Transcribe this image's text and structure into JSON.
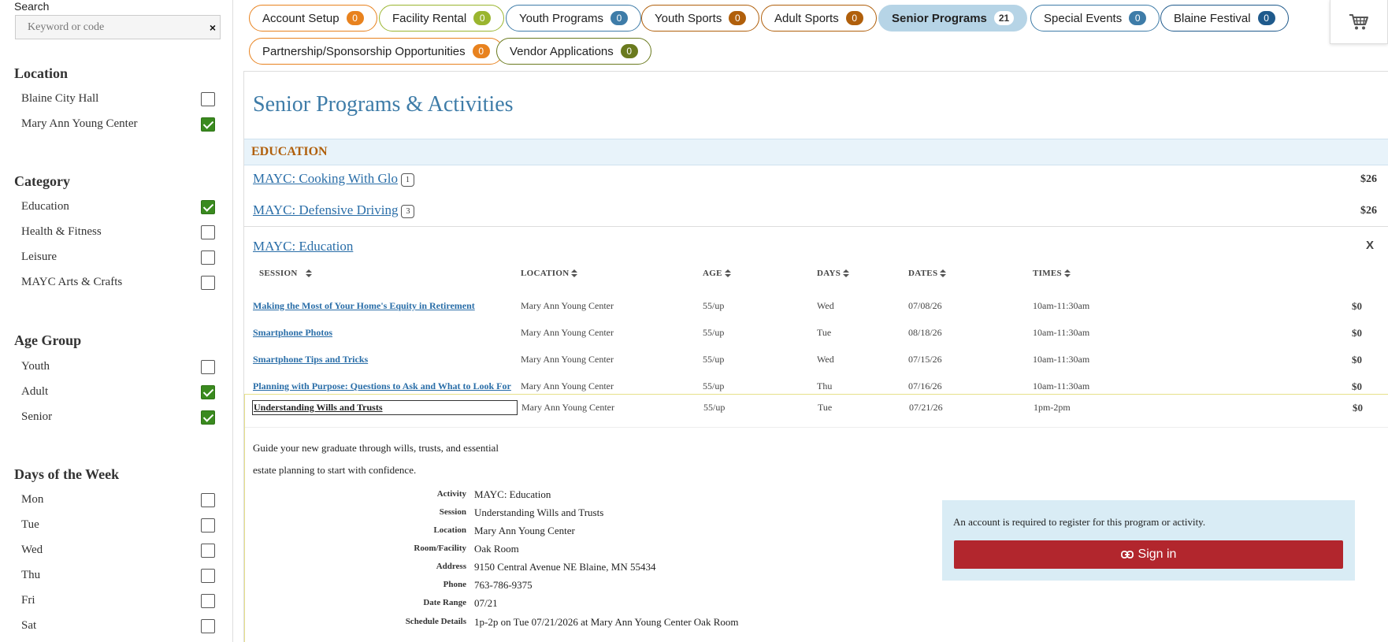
{
  "sidebar": {
    "search_label": "Search",
    "search_placeholder": "Keyword or code",
    "clear_icon": "×",
    "groups": [
      {
        "title": "Location",
        "items": [
          {
            "label": "Blaine City Hall",
            "checked": false
          },
          {
            "label": "Mary Ann Young Center",
            "checked": true
          }
        ]
      },
      {
        "title": "Category",
        "items": [
          {
            "label": "Education",
            "checked": true
          },
          {
            "label": "Health & Fitness",
            "checked": false
          },
          {
            "label": "Leisure",
            "checked": false
          },
          {
            "label": "MAYC Arts & Crafts",
            "checked": false
          }
        ]
      },
      {
        "title": "Age Group",
        "items": [
          {
            "label": "Youth",
            "checked": false
          },
          {
            "label": "Adult",
            "checked": true
          },
          {
            "label": "Senior",
            "checked": true
          }
        ]
      },
      {
        "title": "Days of the Week",
        "items": [
          {
            "label": "Mon",
            "checked": false
          },
          {
            "label": "Tue",
            "checked": false
          },
          {
            "label": "Wed",
            "checked": false
          },
          {
            "label": "Thu",
            "checked": false
          },
          {
            "label": "Fri",
            "checked": false
          },
          {
            "label": "Sat",
            "checked": false
          }
        ]
      }
    ]
  },
  "tabs": [
    {
      "label": "Account Setup",
      "count": "0",
      "color": "#e8821e",
      "active": false
    },
    {
      "label": "Facility Rental",
      "count": "0",
      "color": "#9ab52f",
      "active": false
    },
    {
      "label": "Youth Programs",
      "count": "0",
      "color": "#3e7ca8",
      "active": false
    },
    {
      "label": "Youth Sports",
      "count": "0",
      "color": "#b05f0b",
      "active": false
    },
    {
      "label": "Adult Sports",
      "count": "0",
      "color": "#b05f0b",
      "active": false
    },
    {
      "label": "Senior Programs",
      "count": "21",
      "color": "#3e7ca8",
      "active": true
    },
    {
      "label": "Special Events",
      "count": "0",
      "color": "#3e7ca8",
      "active": false
    },
    {
      "label": "Blaine Festival",
      "count": "0",
      "color": "#1f5a8c",
      "active": false
    },
    {
      "label": "Partnership/Sponsorship Opportunities",
      "count": "0",
      "color": "#e8821e",
      "active": false
    },
    {
      "label": "Vendor Applications",
      "count": "0",
      "color": "#6a7a1e",
      "active": false
    }
  ],
  "cart_icon": "shopping-cart-icon",
  "main": {
    "page_title": "Senior Programs & Activities",
    "section_title": "EDUCATION",
    "activities": [
      {
        "name": "MAYC: Cooking With Glo",
        "badge": "1",
        "price": "$26"
      },
      {
        "name": "MAYC: Defensive Driving",
        "badge": "3",
        "price": "$26"
      },
      {
        "name": "MAYC: Education",
        "close": "X"
      }
    ],
    "table": {
      "headers": [
        "SESSION",
        "LOCATION",
        "AGE",
        "DAYS",
        "DATES",
        "TIMES"
      ],
      "rows": [
        {
          "session": "Making the Most of Your Home's Equity in Retirement",
          "location": "Mary Ann Young Center",
          "age": "55/up",
          "days": "Wed",
          "dates": "07/08/26",
          "times": "10am-11:30am",
          "price": "$0"
        },
        {
          "session": "Smartphone Photos",
          "location": "Mary Ann Young Center",
          "age": "55/up",
          "days": "Tue",
          "dates": "08/18/26",
          "times": "10am-11:30am",
          "price": "$0"
        },
        {
          "session": "Smartphone Tips and Tricks",
          "location": "Mary Ann Young Center",
          "age": "55/up",
          "days": "Wed",
          "dates": "07/15/26",
          "times": "10am-11:30am",
          "price": "$0"
        },
        {
          "session": "Planning with Purpose: Questions to Ask and What to Look For",
          "location": "Mary Ann Young Center",
          "age": "55/up",
          "days": "Thu",
          "dates": "07/16/26",
          "times": "10am-11:30am",
          "price": "$0"
        },
        {
          "session": "Understanding Wills and Trusts",
          "location": "Mary Ann Young Center",
          "age": "55/up",
          "days": "Tue",
          "dates": "07/21/26",
          "times": "1pm-2pm",
          "price": "$0"
        }
      ]
    },
    "details": {
      "description": "Guide your new graduate through wills, trusts, and essential estate planning to start with confidence.",
      "fields": [
        {
          "k": "Activity",
          "v": "MAYC: Education"
        },
        {
          "k": "Session",
          "v": "Understanding Wills and Trusts"
        },
        {
          "k": "Location",
          "v": "Mary Ann Young Center"
        },
        {
          "k": "Room/Facility",
          "v": "Oak Room"
        },
        {
          "k": "Address",
          "v": "9150 Central Avenue NE Blaine, MN 55434"
        },
        {
          "k": "Phone",
          "v": "763-786-9375"
        },
        {
          "k": "Date Range",
          "v": "07/21"
        },
        {
          "k": "Schedule Details",
          "v": "1p-2p on Tue 07/21/2026 at Mary Ann Young Center Oak Room"
        }
      ],
      "account_message": "An account is required to register for this program or activity.",
      "signin_label": "Sign in",
      "signin_icon": "sign-in-icon"
    }
  }
}
